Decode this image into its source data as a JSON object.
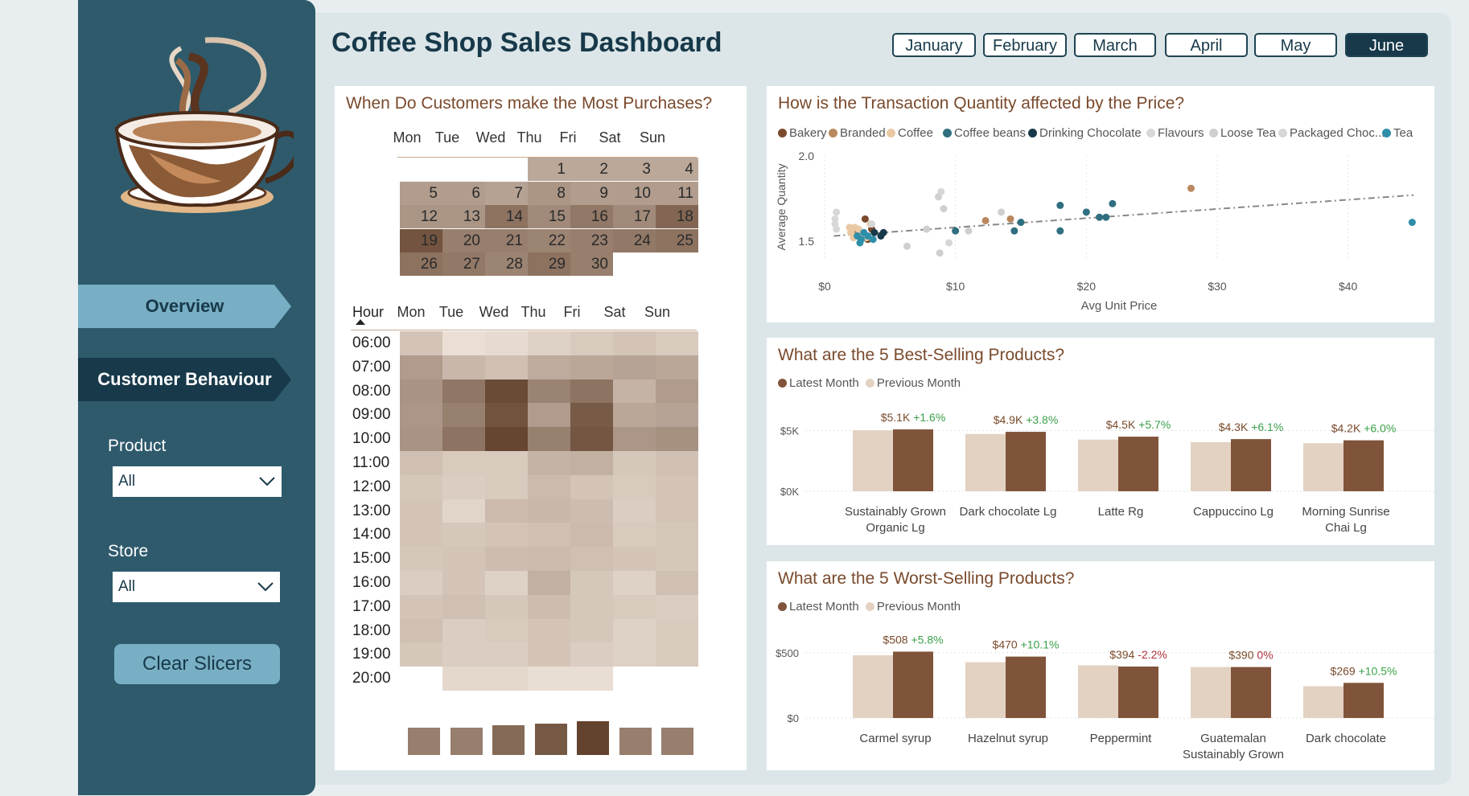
{
  "dashboard_title": "Coffee Shop Sales Dashboard",
  "months": [
    "January",
    "February",
    "March",
    "April",
    "May",
    "June"
  ],
  "active_month": "June",
  "nav": {
    "overview": "Overview",
    "customer_behaviour": "Customer Behaviour"
  },
  "filters": {
    "product_label": "Product",
    "product_value": "All",
    "store_label": "Store",
    "store_value": "All",
    "clear_label": "Clear Slicers"
  },
  "calendar": {
    "title": "When Do Customers make the Most Purchases?",
    "days": [
      "Mon",
      "Tue",
      "Wed",
      "Thu",
      "Fri",
      "Sat",
      "Sun"
    ],
    "hour_label": "Hour",
    "weeks": [
      [
        null,
        null,
        null,
        1,
        2,
        3,
        4
      ],
      [
        5,
        6,
        7,
        8,
        9,
        10,
        11
      ],
      [
        12,
        13,
        14,
        15,
        16,
        17,
        18
      ],
      [
        19,
        20,
        21,
        22,
        23,
        24,
        25
      ],
      [
        26,
        27,
        28,
        29,
        30,
        null,
        null
      ]
    ],
    "intensity": [
      [
        null,
        null,
        null,
        0.15,
        0.15,
        0.15,
        0.15
      ],
      [
        0.25,
        0.25,
        0.2,
        0.3,
        0.25,
        0.25,
        0.25
      ],
      [
        0.3,
        0.3,
        0.6,
        0.4,
        0.55,
        0.4,
        0.7
      ],
      [
        0.85,
        0.5,
        0.5,
        0.45,
        0.5,
        0.55,
        0.6
      ],
      [
        0.6,
        0.55,
        0.45,
        0.6,
        0.5,
        null,
        null
      ]
    ]
  },
  "heatmap": {
    "hours": [
      "06:00",
      "07:00",
      "08:00",
      "09:00",
      "10:00",
      "11:00",
      "12:00",
      "13:00",
      "14:00",
      "15:00",
      "16:00",
      "17:00",
      "18:00",
      "19:00",
      "20:00"
    ],
    "values": [
      [
        0.2,
        0.03,
        0.06,
        0.12,
        0.16,
        0.2,
        0.16
      ],
      [
        0.45,
        0.28,
        0.22,
        0.35,
        0.38,
        0.4,
        0.38
      ],
      [
        0.5,
        0.68,
        0.95,
        0.6,
        0.7,
        0.3,
        0.45
      ],
      [
        0.48,
        0.62,
        0.9,
        0.45,
        0.85,
        0.38,
        0.4
      ],
      [
        0.5,
        0.7,
        0.98,
        0.62,
        0.88,
        0.48,
        0.52
      ],
      [
        0.22,
        0.16,
        0.16,
        0.3,
        0.32,
        0.18,
        0.22
      ],
      [
        0.18,
        0.14,
        0.16,
        0.26,
        0.2,
        0.16,
        0.2
      ],
      [
        0.2,
        0.1,
        0.26,
        0.28,
        0.24,
        0.14,
        0.2
      ],
      [
        0.2,
        0.18,
        0.2,
        0.22,
        0.26,
        0.16,
        0.18
      ],
      [
        0.18,
        0.2,
        0.24,
        0.26,
        0.22,
        0.2,
        0.18
      ],
      [
        0.14,
        0.2,
        0.12,
        0.32,
        0.18,
        0.12,
        0.22
      ],
      [
        0.2,
        0.22,
        0.18,
        0.24,
        0.18,
        0.16,
        0.14
      ],
      [
        0.22,
        0.14,
        0.16,
        0.2,
        0.18,
        0.12,
        0.16
      ],
      [
        0.18,
        0.14,
        0.14,
        0.2,
        0.14,
        0.12,
        0.16
      ],
      [
        null,
        0.08,
        0.08,
        0.04,
        0.04,
        null,
        null
      ]
    ],
    "day_totals": [
      0.6,
      0.6,
      0.72,
      0.82,
      0.95,
      0.6,
      0.6
    ]
  },
  "scatter": {
    "title": "How is the Transaction Quantity affected by the Price?",
    "legend": [
      {
        "name": "Bakery",
        "color": "#7a4a2c"
      },
      {
        "name": "Branded",
        "color": "#b9885e"
      },
      {
        "name": "Coffee",
        "color": "#e9c9a4"
      },
      {
        "name": "Coffee beans",
        "color": "#2f6f80"
      },
      {
        "name": "Drinking Chocolate",
        "color": "#18394a"
      },
      {
        "name": "Flavours",
        "color": "#d8d8d8"
      },
      {
        "name": "Loose Tea",
        "color": "#cfcfcf"
      },
      {
        "name": "Packaged Choc...",
        "color": "#d6d6d6"
      },
      {
        "name": "Tea",
        "color": "#2f8ea8"
      }
    ]
  },
  "best": {
    "title": "What are the 5 Best-Selling Products?",
    "legend_latest": "Latest Month",
    "legend_previous": "Previous Month",
    "y_ticks": [
      "$5K",
      "$0K"
    ],
    "labels": [
      "$5.1K",
      "$4.9K",
      "$4.5K",
      "$4.3K",
      "$4.2K"
    ],
    "deltas": [
      "+1.6%",
      "+3.8%",
      "+5.7%",
      "+6.1%",
      "+6.0%"
    ],
    "products": [
      [
        "Sustainably Grown",
        "Organic Lg"
      ],
      [
        "Dark chocolate Lg"
      ],
      [
        "Latte Rg"
      ],
      [
        "Cappuccino Lg"
      ],
      [
        "Morning Sunrise",
        "Chai Lg"
      ]
    ]
  },
  "worst": {
    "title": "What are the 5 Worst-Selling Products?",
    "legend_latest": "Latest Month",
    "legend_previous": "Previous Month",
    "y_ticks": [
      "$500",
      "$0"
    ],
    "labels": [
      "$508",
      "$470",
      "$394",
      "$390",
      "$269"
    ],
    "deltas": [
      "+5.8%",
      "+10.1%",
      "-2.2%",
      "0%",
      "+10.5%"
    ],
    "products": [
      [
        "Carmel syrup"
      ],
      [
        "Hazelnut syrup"
      ],
      [
        "Peppermint"
      ],
      [
        "Guatemalan",
        "Sustainably Grown"
      ],
      [
        "Dark chocolate"
      ]
    ]
  },
  "chart_data": [
    {
      "type": "scatter",
      "title": "How is the Transaction Quantity affected by the Price?",
      "xlabel": "Avg Unit Price",
      "ylabel": "Average Quantity",
      "x_ticks": [
        "$0",
        "$10",
        "$20",
        "$30",
        "$40"
      ],
      "y_ticks": [
        "2.0",
        "1.5"
      ],
      "xlim": [
        0,
        45
      ],
      "ylim": [
        1.4,
        2.0
      ],
      "trendline": [
        [
          0.7,
          1.53
        ],
        [
          45,
          1.77
        ]
      ],
      "series": [
        {
          "name": "Bakery",
          "color": "#7a4a2c",
          "points": [
            [
              3.1,
              1.63
            ],
            [
              3.6,
              1.57
            ],
            [
              3.3,
              1.51
            ]
          ]
        },
        {
          "name": "Branded",
          "color": "#b9885e",
          "points": [
            [
              28,
              1.81
            ],
            [
              12.3,
              1.62
            ],
            [
              14.2,
              1.63
            ],
            [
              2.5,
              1.56
            ]
          ]
        },
        {
          "name": "Coffee",
          "color": "#e9c9a4",
          "points": [
            [
              2.0,
              1.55
            ],
            [
              2.3,
              1.58
            ],
            [
              2.6,
              1.57
            ],
            [
              2.8,
              1.54
            ],
            [
              3.2,
              1.52
            ],
            [
              3.5,
              1.6
            ],
            [
              2.2,
              1.52
            ],
            [
              1.9,
              1.58
            ]
          ]
        },
        {
          "name": "Coffee beans",
          "color": "#2f6f80",
          "points": [
            [
              18,
              1.71
            ],
            [
              20,
              1.67
            ],
            [
              22,
              1.72
            ],
            [
              21,
              1.64
            ],
            [
              15,
              1.61
            ],
            [
              10,
              1.56
            ],
            [
              14.5,
              1.56
            ],
            [
              18,
              1.56
            ],
            [
              21.5,
              1.64
            ]
          ]
        },
        {
          "name": "Drinking Chocolate",
          "color": "#18394a",
          "points": [
            [
              4.5,
              1.55
            ],
            [
              4.3,
              1.53
            ],
            [
              3.8,
              1.55
            ]
          ]
        },
        {
          "name": "Flavours",
          "color": "#d8d8d8",
          "points": [
            [
              0.8,
              1.63
            ],
            [
              0.8,
              1.6
            ],
            [
              0.9,
              1.67
            ],
            [
              0.9,
              1.57
            ]
          ]
        },
        {
          "name": "Loose Tea",
          "color": "#cfcfcf",
          "points": [
            [
              8.7,
              1.76
            ],
            [
              9.1,
              1.69
            ],
            [
              11,
              1.56
            ],
            [
              13.5,
              1.67
            ],
            [
              6.3,
              1.47
            ],
            [
              8.8,
              1.43
            ],
            [
              7.8,
              1.57
            ]
          ]
        },
        {
          "name": "Packaged Choc...",
          "color": "#d6d6d6",
          "points": [
            [
              8.9,
              1.79
            ],
            [
              9.5,
              1.49
            ],
            [
              3.6,
              1.6
            ]
          ]
        },
        {
          "name": "Tea",
          "color": "#2f8ea8",
          "points": [
            [
              2.5,
              1.53
            ],
            [
              2.8,
              1.51
            ],
            [
              3,
              1.55
            ],
            [
              3.3,
              1.53
            ],
            [
              2.7,
              1.49
            ],
            [
              3.7,
              1.51
            ],
            [
              44.9,
              1.61
            ]
          ]
        }
      ]
    },
    {
      "type": "bar",
      "title": "What are the 5 Best-Selling Products?",
      "categories": [
        "Sustainably Grown Organic Lg",
        "Dark chocolate Lg",
        "Latte Rg",
        "Cappuccino Lg",
        "Morning Sunrise Chai Lg"
      ],
      "ylim": [
        0,
        5500
      ],
      "series": [
        {
          "name": "Previous Month",
          "color": "#e3d2c2",
          "values": [
            5020,
            4720,
            4260,
            4050,
            3960
          ]
        },
        {
          "name": "Latest Month",
          "color": "#80543a",
          "values": [
            5100,
            4900,
            4500,
            4300,
            4200
          ]
        }
      ]
    },
    {
      "type": "bar",
      "title": "What are the 5 Worst-Selling Products?",
      "categories": [
        "Carmel syrup",
        "Hazelnut syrup",
        "Peppermint",
        "Guatemalan Sustainably Grown",
        "Dark chocolate"
      ],
      "ylim": [
        0,
        560
      ],
      "series": [
        {
          "name": "Previous Month",
          "color": "#e3d2c2",
          "values": [
            480,
            427,
            403,
            390,
            243
          ]
        },
        {
          "name": "Latest Month",
          "color": "#80543a",
          "values": [
            508,
            470,
            394,
            390,
            269
          ]
        }
      ]
    }
  ]
}
